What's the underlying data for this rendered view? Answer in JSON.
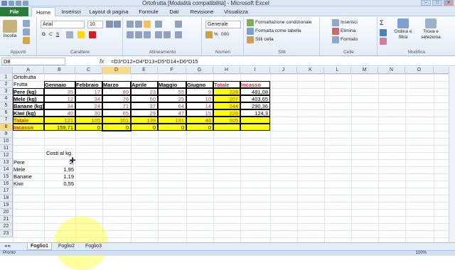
{
  "window": {
    "title": "Ortofrutta [Modalità compatibilità] - Microsoft Excel",
    "buttons": [
      "–",
      "□",
      "✕"
    ]
  },
  "tabs": [
    "File",
    "Home",
    "Inserisci",
    "Layout di pagina",
    "Formule",
    "Dati",
    "Revisione",
    "Visualizza"
  ],
  "active_tab": "Home",
  "ribbon": {
    "clipboard": {
      "paste": "Incolla",
      "label": "Appunti"
    },
    "font": {
      "name": "Arial",
      "size": "10",
      "label": "Carattere"
    },
    "alignment": {
      "label": "Allineamento"
    },
    "number": {
      "format": "Generale",
      "label": "Numeri"
    },
    "styles": {
      "conditional": "Formattazione condizionale",
      "table": "Formatta come tabella",
      "cell": "Stili cella",
      "label": "Stili"
    },
    "cells": {
      "insert": "Inserisci",
      "delete": "Elimina",
      "format": "Formato",
      "label": "Celle"
    },
    "editing": {
      "sort": "Ordina e filtra",
      "find": "Trova e seleziona",
      "label": "Modifica"
    }
  },
  "formula_bar": {
    "name_box": "D8",
    "fx": "fx",
    "formula": "=D3*D12+D4*D13+D5*D14+D6*D15"
  },
  "columns": [
    "A",
    "B",
    "C",
    "D",
    "E",
    "F",
    "G",
    "H",
    "I",
    "J",
    "K",
    "L",
    "M",
    "N",
    "O"
  ],
  "rows": [
    "1",
    "2",
    "3",
    "4",
    "5",
    "6",
    "7",
    "8",
    "9",
    "10",
    "11",
    "12",
    "13",
    "14",
    "15",
    "16",
    "17",
    "18",
    "19",
    "20",
    "21",
    "22",
    "23"
  ],
  "sheet": {
    "a1": "Ortofrutta",
    "header": [
      "Frutta",
      "Gennaio",
      "Febbraio",
      "Marzo",
      "Aprile",
      "Maggio",
      "Giugno",
      "Totale",
      "Incasso"
    ],
    "data": [
      {
        "label": "Pere (kg)",
        "values": [
          "35",
          "17",
          "89",
          "23",
          "55",
          "9"
        ],
        "total": "228",
        "incasso": "481,08"
      },
      {
        "label": "Mele (kg)",
        "values": [
          "12",
          "34",
          "76",
          "50",
          "25",
          "10"
        ],
        "total": "207",
        "incasso": "403,65"
      },
      {
        "label": "Banane (kg)",
        "values": [
          "34",
          "24",
          "71",
          "37",
          "64",
          "14"
        ],
        "total": "244",
        "incasso": "290,36"
      },
      {
        "label": "Kiwi (kg)",
        "values": [
          "40",
          "30",
          "65",
          "29",
          "47",
          "15"
        ],
        "total": "226",
        "incasso": "124,3"
      }
    ],
    "totale": {
      "label": "Totale",
      "values": [
        "121",
        "105",
        "301",
        "139",
        "191",
        "48"
      ],
      "total": "905"
    },
    "incasso": {
      "label": "Incasso",
      "values": [
        "159,71",
        "0",
        "0",
        "0",
        "0",
        "0"
      ]
    },
    "costi_header": "Costi al kg",
    "costi": [
      {
        "label": "Pere",
        "value": "2,"
      },
      {
        "label": "Mele",
        "value": "1,95"
      },
      {
        "label": "Banane",
        "value": "1,19"
      },
      {
        "label": "Kiwi",
        "value": "0,55"
      }
    ]
  },
  "sheet_tabs": [
    "Foglio1",
    "Foglio2",
    "Foglio3"
  ],
  "active_sheet": "Foglio1",
  "status": {
    "left": "Pronto",
    "zoom": "100%"
  }
}
